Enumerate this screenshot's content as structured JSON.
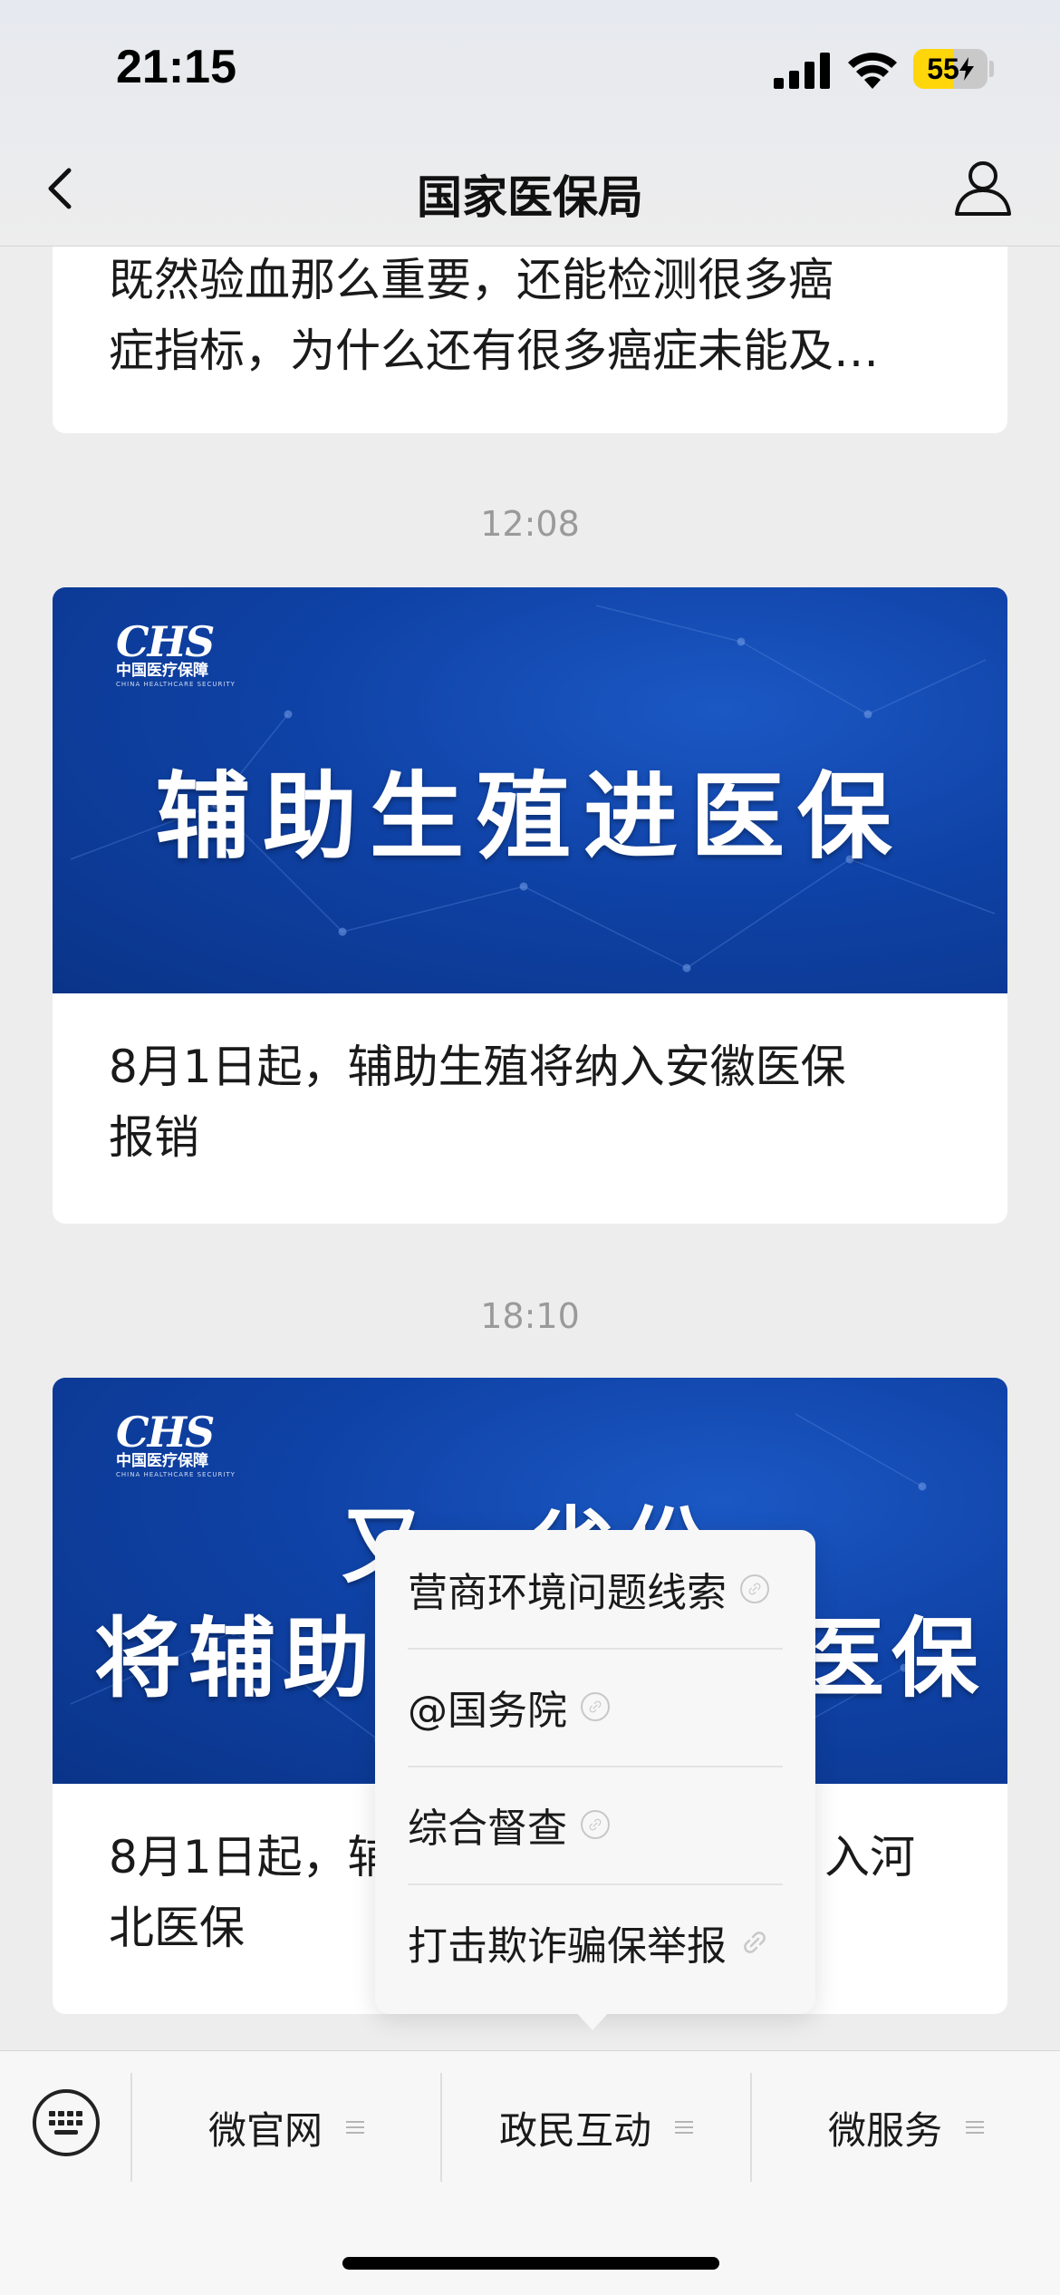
{
  "status_bar": {
    "time": "21:15",
    "battery": "55",
    "battery_level": 0.55
  },
  "nav": {
    "title": "国家医保局"
  },
  "feed": {
    "top_card": {
      "text_line1": "既然验血那么重要，还能检测很多癌",
      "text_line2": "症指标，为什么还有很多癌症未能及…"
    },
    "message1": {
      "time": "12:08",
      "logo_mark": "CHS",
      "logo_cn": "中国医疗保障",
      "logo_en": "CHINA HEALTHCARE SECURITY",
      "banner_title": "辅助生殖进医保",
      "text_line1": "8月1日起，辅助生殖将纳入安徽医保",
      "text_line2": "报销"
    },
    "message2": {
      "time": "18:10",
      "logo_mark": "CHS",
      "logo_cn": "中国医疗保障",
      "logo_en": "CHINA HEALTHCARE SECURITY",
      "banner_line1": "又一省份",
      "banner_line2_left": "将辅助",
      "banner_line2_right": "医保",
      "text_line1_left": "8月1日起，",
      "text_line1_partial": "辅",
      "text_line1_right": "入河",
      "text_line2": "北医保"
    }
  },
  "popup_menu": {
    "items": [
      {
        "label": "营商环境问题线索",
        "icon": "link-icon"
      },
      {
        "label": "@国务院",
        "icon": "link-icon"
      },
      {
        "label": "综合督查",
        "icon": "link-icon"
      },
      {
        "label": "打击欺诈骗保举报",
        "icon": "link-icon"
      }
    ]
  },
  "bottom_menu": {
    "tabs": [
      {
        "label": "微官网"
      },
      {
        "label": "政民互动"
      },
      {
        "label": "微服务"
      }
    ]
  },
  "colors": {
    "banner_blue": "#0f42a6",
    "battery_yellow": "#ffd60a",
    "background": "#ededed"
  }
}
